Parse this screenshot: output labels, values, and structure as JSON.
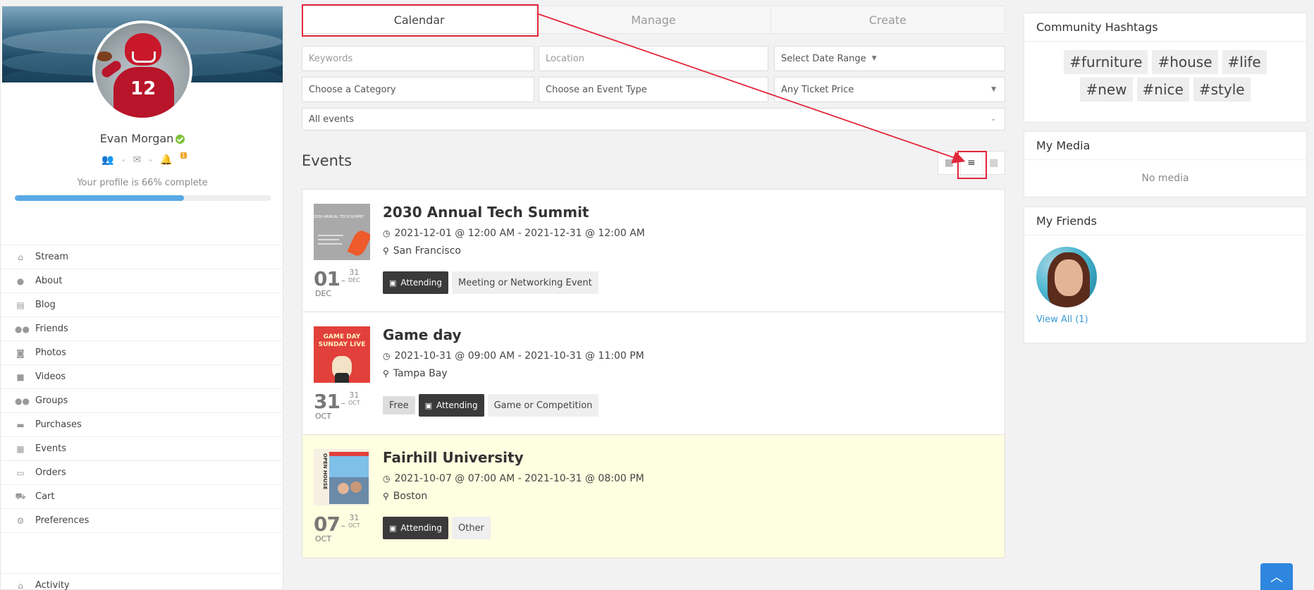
{
  "profile": {
    "name": "Evan Morgan",
    "notif_count": "1",
    "complete_text": "Your profile is 66% complete",
    "complete_fraction": 0.66
  },
  "nav": {
    "items": [
      {
        "label": "Stream",
        "icon": "home-icon",
        "glyph": "⌂"
      },
      {
        "label": "About",
        "icon": "user-icon",
        "glyph": "●"
      },
      {
        "label": "Blog",
        "icon": "newspaper-icon",
        "glyph": "▤"
      },
      {
        "label": "Friends",
        "icon": "users-icon",
        "glyph": "●●"
      },
      {
        "label": "Photos",
        "icon": "camera-icon",
        "glyph": "◙"
      },
      {
        "label": "Videos",
        "icon": "video-icon",
        "glyph": "■"
      },
      {
        "label": "Groups",
        "icon": "group-icon",
        "glyph": "●●"
      },
      {
        "label": "Purchases",
        "icon": "credit-card-icon",
        "glyph": "▬"
      },
      {
        "label": "Events",
        "icon": "calendar-icon",
        "glyph": "▦"
      },
      {
        "label": "Orders",
        "icon": "money-icon",
        "glyph": "▭"
      },
      {
        "label": "Cart",
        "icon": "cart-icon",
        "glyph": "⛟"
      },
      {
        "label": "Preferences",
        "icon": "gear-icon",
        "glyph": "⚙"
      }
    ],
    "activity": {
      "label": "Activity",
      "icon": "home-icon",
      "glyph": "⌂"
    }
  },
  "tabs": [
    "Calendar",
    "Manage",
    "Create"
  ],
  "filters": {
    "keywords_placeholder": "Keywords",
    "location_placeholder": "Location",
    "date_range": "Select Date Range",
    "category": "Choose a Category",
    "event_type": "Choose an Event Type",
    "ticket_price": "Any Ticket Price",
    "scope": "All events"
  },
  "events_heading": "Events",
  "view_modes": [
    {
      "icon": "grid-view-icon",
      "glyph": "■"
    },
    {
      "icon": "list-view-icon",
      "glyph": "≡"
    },
    {
      "icon": "calendar-view-icon",
      "glyph": "▦"
    }
  ],
  "events": [
    {
      "title": "2030 Annual Tech Summit",
      "time": "2021-12-01 @ 12:00 AM - 2021-12-31 @ 12:00 AM",
      "location": "San Francisco",
      "start_day": "01",
      "end_day": "31",
      "end_month": "DEC",
      "start_month": "DEC",
      "free": "",
      "attending": "Attending",
      "type": "Meeting or Networking Event",
      "thumb_text": "2030 ANNUAL TECH SUMMIT"
    },
    {
      "title": "Game day",
      "time": "2021-10-31 @ 09:00 AM - 2021-10-31 @ 11:00 PM",
      "location": "Tampa Bay",
      "start_day": "31",
      "end_day": "31",
      "end_month": "OCT",
      "start_month": "OCT",
      "free": "Free",
      "attending": "Attending",
      "type": "Game or Competition",
      "thumb_text": "GAME DAY SUNDAY LIVE"
    },
    {
      "title": "Fairhill University",
      "time": "2021-10-07 @ 07:00 AM - 2021-10-31 @ 08:00 PM",
      "location": "Boston",
      "start_day": "07",
      "end_day": "31",
      "end_month": "OCT",
      "start_month": "OCT",
      "free": "",
      "attending": "Attending",
      "type": "Other",
      "thumb_text": "OPEN HOUSE"
    }
  ],
  "right": {
    "hashtags_title": "Community Hashtags",
    "hashtags": [
      "#furniture",
      "#house",
      "#life",
      "#new",
      "#nice",
      "#style"
    ],
    "media_title": "My Media",
    "no_media": "No media",
    "friends_title": "My Friends",
    "view_all": "View All (1)"
  },
  "colors": {
    "highlight": "#e3263a",
    "progress": "#5aa9e6",
    "link": "#3a9ad9",
    "scroll_top": "#2f86de",
    "event_highlight": "#fefee0"
  }
}
